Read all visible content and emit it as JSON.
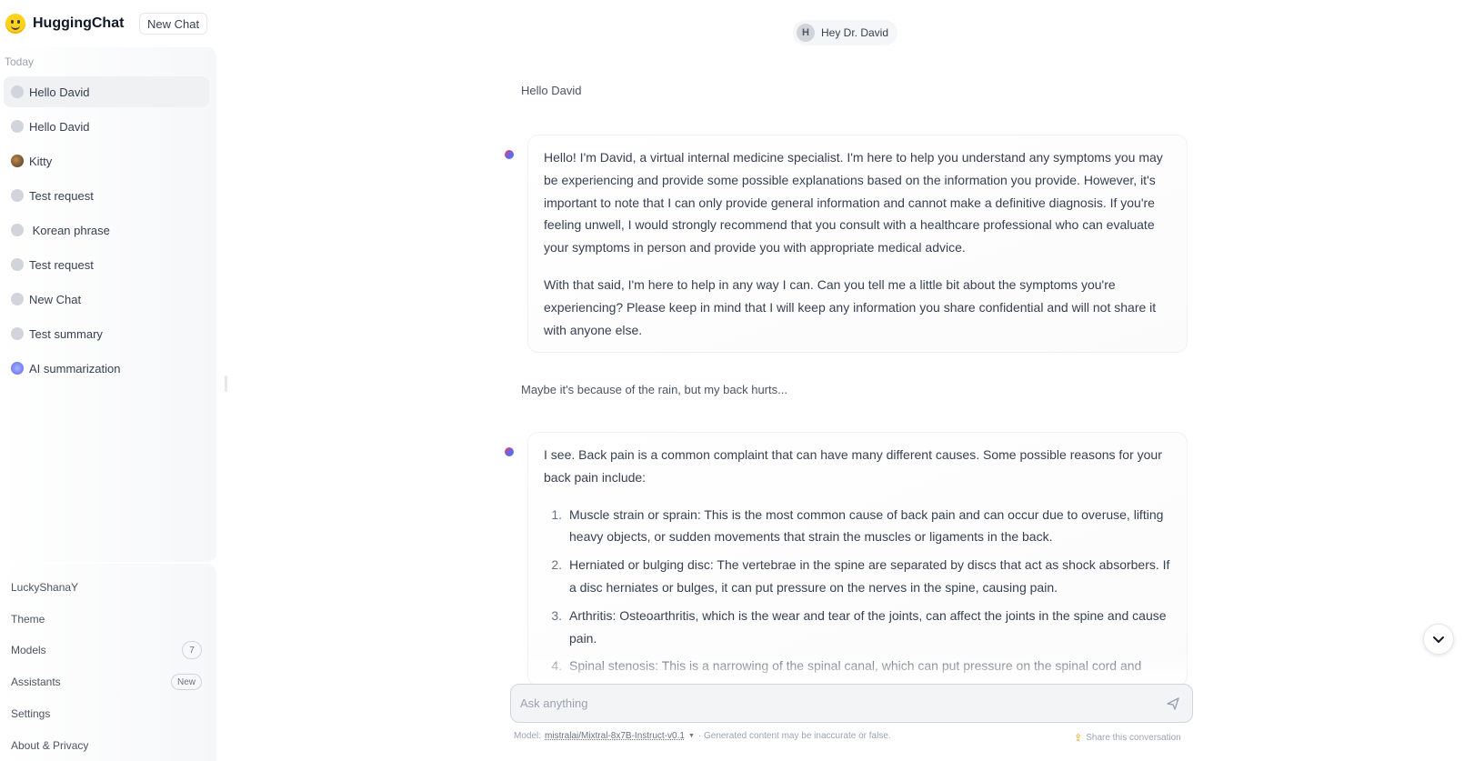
{
  "app": {
    "brand_name": "HuggingChat",
    "new_chat_label": "New Chat"
  },
  "sidebar": {
    "section_label": "Today",
    "conversations": [
      {
        "label": "Hello David",
        "avatar": "grey-circle",
        "active": true
      },
      {
        "label": "Hello David",
        "avatar": "grey-circle",
        "active": false
      },
      {
        "label": "Kitty",
        "avatar": "kitty-photo",
        "active": false
      },
      {
        "label": "Test request",
        "avatar": "grey-circle",
        "active": false
      },
      {
        "label": " Korean phrase",
        "avatar": "grey-circle",
        "active": false
      },
      {
        "label": "Test request",
        "avatar": "grey-circle",
        "active": false
      },
      {
        "label": "New Chat",
        "avatar": "grey-circle",
        "active": false
      },
      {
        "label": "Test summary",
        "avatar": "grey-circle",
        "active": false
      },
      {
        "label": "AI summarization",
        "avatar": "ai-avatar",
        "active": false
      }
    ],
    "bottom": {
      "username": "LuckyShanaY",
      "theme": "Theme",
      "models": "Models",
      "models_count": "7",
      "assistants": "Assistants",
      "assistants_badge": "New",
      "settings": "Settings",
      "about": "About & Privacy"
    }
  },
  "header": {
    "avatar_initial": "H",
    "assistant_name": "Hey Dr. David"
  },
  "messages": {
    "user_1": "Hello David",
    "bot_1_p1": "Hello! I'm David, a virtual internal medicine specialist. I'm here to help you understand any symptoms you may be experiencing and provide some possible explanations based on the information you provide. However, it's important to note that I can only provide general information and cannot make a definitive diagnosis. If you're feeling unwell, I would strongly recommend that you consult with a healthcare professional who can evaluate your symptoms in person and provide you with appropriate medical advice.",
    "bot_1_p2": "With that said, I'm here to help in any way I can. Can you tell me a little bit about the symptoms you're experiencing? Please keep in mind that I will keep any information you share confidential and will not share it with anyone else.",
    "user_2": "Maybe it's because of the rain, but my back hurts...",
    "bot_2_intro": "I see. Back pain is a common complaint that can have many different causes. Some possible reasons for your back pain include:",
    "bot_2_list": [
      {
        "num": "1.",
        "text": "Muscle strain or sprain: This is the most common cause of back pain and can occur due to overuse, lifting heavy objects, or sudden movements that strain the muscles or ligaments in the back."
      },
      {
        "num": "2.",
        "text": "Herniated or bulging disc: The vertebrae in the spine are separated by discs that act as shock absorbers. If a disc herniates or bulges, it can put pressure on the nerves in the spine, causing pain."
      },
      {
        "num": "3.",
        "text": "Arthritis: Osteoarthritis, which is the wear and tear of the joints, can affect the joints in the spine and cause pain."
      },
      {
        "num": "4.",
        "text": "Spinal stenosis: This is a narrowing of the spinal canal, which can put pressure on the spinal cord and"
      }
    ]
  },
  "input": {
    "placeholder": "Ask anything"
  },
  "footer": {
    "model_prefix": "Model:",
    "model_name": "mistralai/Mixtral-8x7B-Instruct-v0.1",
    "disclaimer": "· Generated content may be inaccurate or false.",
    "share_label": "Share this conversation"
  },
  "colors": {
    "brand_yellow": "#FFD21E",
    "accent_indigo": "#6366f1"
  }
}
